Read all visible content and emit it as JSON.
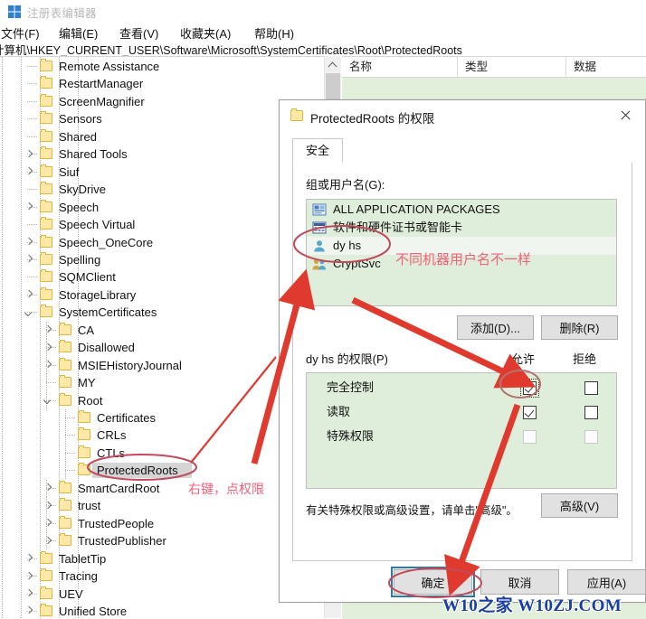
{
  "window": {
    "title": "注册表编辑器",
    "icon": "registry-icon",
    "menus": [
      "文件(F)",
      "编辑(E)",
      "查看(V)",
      "收藏夹(A)",
      "帮助(H)"
    ],
    "address": "计算机\\HKEY_CURRENT_USER\\Software\\Microsoft\\SystemCertificates\\Root\\ProtectedRoots"
  },
  "value_list": {
    "columns": [
      "名称",
      "类型",
      "数据"
    ],
    "rows": []
  },
  "tree": {
    "items": [
      {
        "label": "Remote Assistance",
        "depth": 3,
        "expander": "none"
      },
      {
        "label": "RestartManager",
        "depth": 3,
        "expander": "none"
      },
      {
        "label": "ScreenMagnifier",
        "depth": 3,
        "expander": "none"
      },
      {
        "label": "Sensors",
        "depth": 3,
        "expander": "none"
      },
      {
        "label": "Shared",
        "depth": 3,
        "expander": "none"
      },
      {
        "label": "Shared Tools",
        "depth": 3,
        "expander": "collapsed"
      },
      {
        "label": "Siuf",
        "depth": 3,
        "expander": "collapsed"
      },
      {
        "label": "SkyDrive",
        "depth": 3,
        "expander": "none"
      },
      {
        "label": "Speech",
        "depth": 3,
        "expander": "collapsed"
      },
      {
        "label": "Speech Virtual",
        "depth": 3,
        "expander": "none"
      },
      {
        "label": "Speech_OneCore",
        "depth": 3,
        "expander": "collapsed"
      },
      {
        "label": "Spelling",
        "depth": 3,
        "expander": "collapsed"
      },
      {
        "label": "SQMClient",
        "depth": 3,
        "expander": "none"
      },
      {
        "label": "StorageLibrary",
        "depth": 3,
        "expander": "collapsed"
      },
      {
        "label": "SystemCertificates",
        "depth": 3,
        "expander": "expanded"
      },
      {
        "label": "CA",
        "depth": 4,
        "expander": "collapsed"
      },
      {
        "label": "Disallowed",
        "depth": 4,
        "expander": "collapsed"
      },
      {
        "label": "MSIEHistoryJournal",
        "depth": 4,
        "expander": "collapsed"
      },
      {
        "label": "MY",
        "depth": 4,
        "expander": "none"
      },
      {
        "label": "Root",
        "depth": 4,
        "expander": "expanded"
      },
      {
        "label": "Certificates",
        "depth": 5,
        "expander": "none"
      },
      {
        "label": "CRLs",
        "depth": 5,
        "expander": "none"
      },
      {
        "label": "CTLs",
        "depth": 5,
        "expander": "none"
      },
      {
        "label": "ProtectedRoots",
        "depth": 5,
        "expander": "none",
        "selected": true
      },
      {
        "label": "SmartCardRoot",
        "depth": 4,
        "expander": "collapsed"
      },
      {
        "label": "trust",
        "depth": 4,
        "expander": "collapsed"
      },
      {
        "label": "TrustedPeople",
        "depth": 4,
        "expander": "collapsed"
      },
      {
        "label": "TrustedPublisher",
        "depth": 4,
        "expander": "collapsed"
      },
      {
        "label": "TabletTip",
        "depth": 3,
        "expander": "collapsed"
      },
      {
        "label": "Tracing",
        "depth": 3,
        "expander": "collapsed"
      },
      {
        "label": "UEV",
        "depth": 3,
        "expander": "collapsed"
      },
      {
        "label": "Unified Store",
        "depth": 3,
        "expander": "collapsed"
      }
    ]
  },
  "dialog": {
    "title": "ProtectedRoots 的权限",
    "icon": "folder-icon",
    "close_label": "✕",
    "tab": "安全",
    "group_label": "组或用户名(G):",
    "groups": [
      {
        "name": "ALL APPLICATION PACKAGES",
        "icon": "app-packages-icon",
        "selected": false
      },
      {
        "name": "软件和硬件证书或智能卡",
        "icon": "smartcard-icon",
        "selected": false
      },
      {
        "name": "dy hs",
        "icon": "user-icon",
        "selected": true
      },
      {
        "name": "CryptSvc",
        "icon": "group-icon",
        "selected": false
      }
    ],
    "add_button": "添加(D)...",
    "remove_button": "删除(R)",
    "perm_label": "dy hs 的权限(P)",
    "col_allow": "允许",
    "col_deny": "拒绝",
    "permissions": [
      {
        "name": "完全控制",
        "allow": "checked",
        "deny": "unchecked"
      },
      {
        "name": "读取",
        "allow": "checked",
        "deny": "unchecked"
      },
      {
        "name": "特殊权限",
        "allow": "disabled",
        "deny": "disabled"
      }
    ],
    "advanced_note": "有关特殊权限或高级设置，请单击\"高级\"。",
    "advanced_button": "高级(V)",
    "ok_button": "确定",
    "cancel_button": "取消",
    "apply_button": "应用(A)"
  },
  "annotations": {
    "note_username": "不同机器用户名不一样",
    "note_rightclick": "右键，点权限",
    "watermark": "W10之家 W10ZJ.COM",
    "arrow_color": "#e03a2f",
    "ellipse_color": "#c14b5c",
    "text_color": "#f2607a"
  }
}
